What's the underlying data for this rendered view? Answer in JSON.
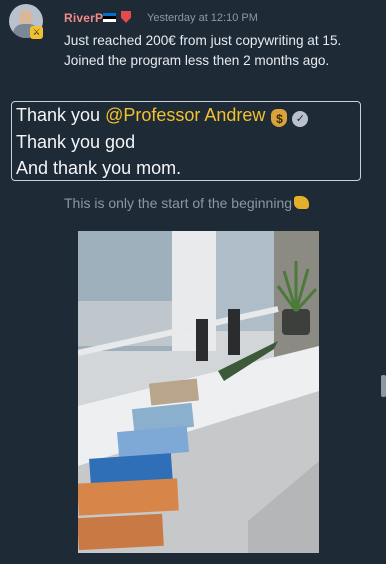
{
  "message": {
    "username": "RiverP",
    "avatar_badge": "⚔",
    "timestamp": "Yesterday at 12:10 PM",
    "body": "Just reached 200€ from just copywriting at 15. Joined the program less then 2 months ago.",
    "quote": {
      "prefix": "Thank you ",
      "mention": "@Professor Andrew",
      "line2": "Thank you god",
      "line3": "And thank you mom."
    },
    "closing": "This is only the start of the beginning"
  },
  "icons": {
    "flag": "estonia-flag-icon",
    "role": "shield-icon",
    "money": "money-bag-icon",
    "verified": "verified-badge-icon",
    "flex": "flexed-biceps-icon"
  },
  "colors": {
    "background": "#1f2a37",
    "username": "#f08a8a",
    "mention": "#f2c12e",
    "muted": "#8c97a3"
  }
}
